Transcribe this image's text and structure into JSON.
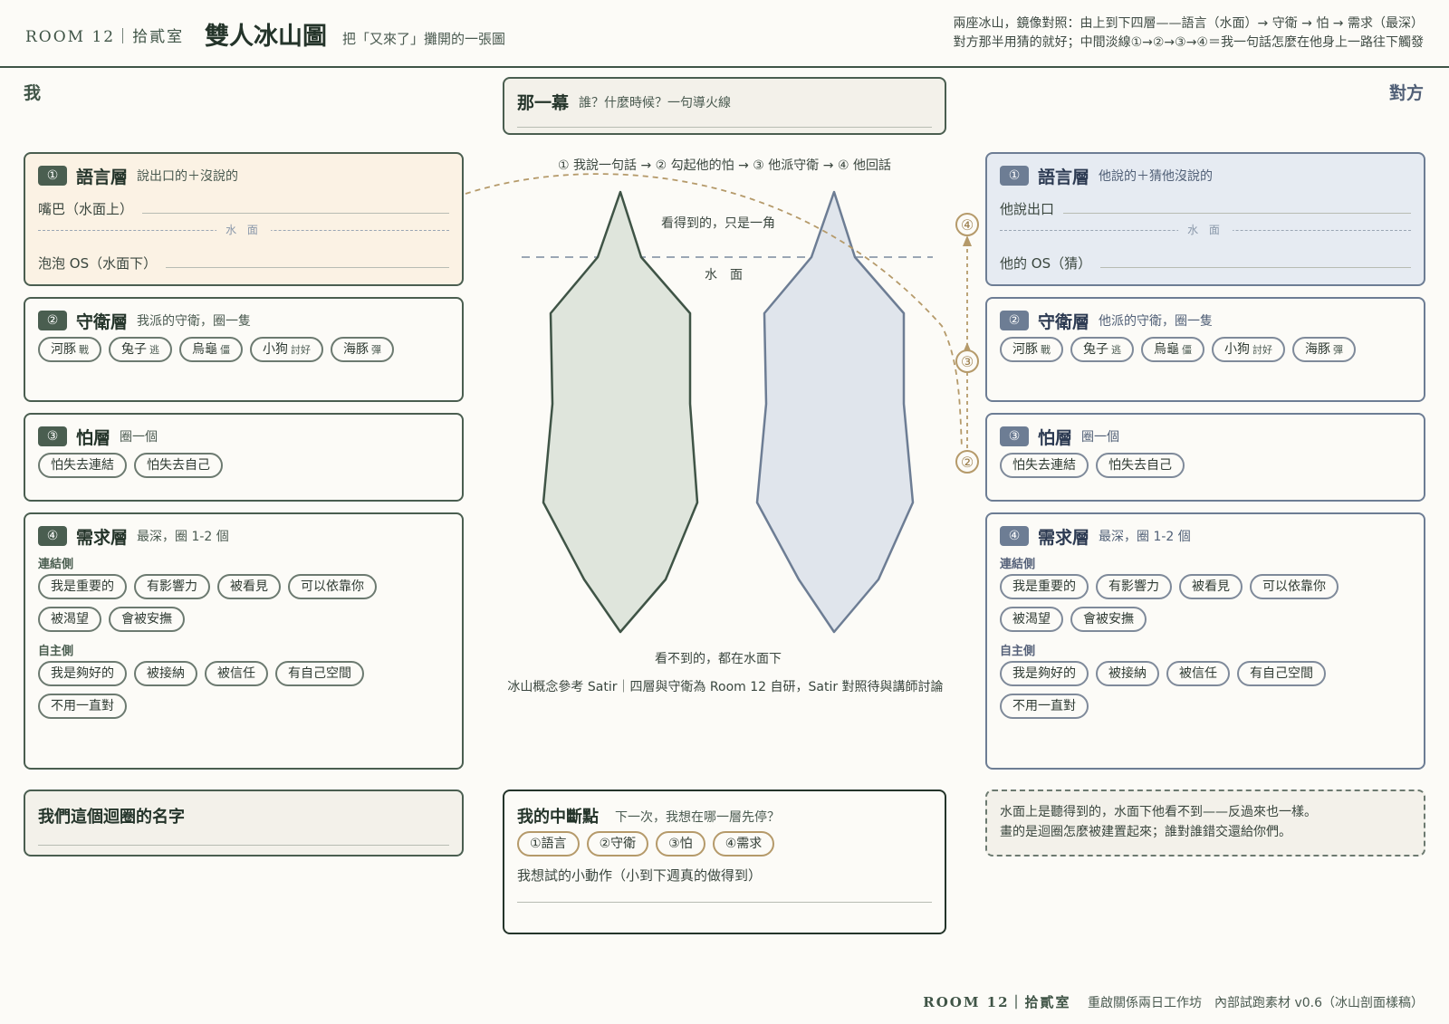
{
  "header": {
    "brand": "ROOM 12｜拾貳室",
    "title": "雙人冰山圖",
    "subtitle": "把「又來了」攤開的一張圖",
    "note_line1": "兩座冰山，鏡像對照：由上到下四層——語言（水面）→ 守衛 → 怕 → 需求（最深）",
    "note_line2": "對方那半用猜的就好；中間淡線①→②→③→④＝我一句話怎麼在他身上一路往下觸發"
  },
  "sides": {
    "me": "我",
    "them": "對方"
  },
  "me": {
    "language": {
      "num": "①",
      "name": "語言層",
      "hint": "說出口的＋沒說的",
      "line1": "嘴巴（水面上）",
      "water": "水 面",
      "line2": "泡泡 OS（水面下）"
    },
    "guard": {
      "num": "②",
      "name": "守衛層",
      "hint": "我派的守衛，圈一隻",
      "chips": [
        {
          "label": "河豚",
          "tag": "戰"
        },
        {
          "label": "兔子",
          "tag": "逃"
        },
        {
          "label": "烏龜",
          "tag": "僵"
        },
        {
          "label": "小狗",
          "tag": "討好"
        },
        {
          "label": "海豚",
          "tag": "彈"
        }
      ]
    },
    "fear": {
      "num": "③",
      "name": "怕層",
      "hint": "圈一個",
      "chips": [
        "怕失去連結",
        "怕失去自己"
      ]
    },
    "need": {
      "num": "④",
      "name": "需求層",
      "hint": "最深，圈 1-2 個",
      "connect_label": "連結側",
      "connect": [
        "我是重要的",
        "有影響力",
        "被看見",
        "可以依靠你",
        "被渴望",
        "會被安撫"
      ],
      "auto_label": "自主側",
      "auto": [
        "我是夠好的",
        "被接納",
        "被信任",
        "有自己空間",
        "不用一直對"
      ]
    }
  },
  "them": {
    "language": {
      "num": "①",
      "name": "語言層",
      "hint": "他說的＋猜他沒說的",
      "line1": "他說出口",
      "water": "水 面",
      "line2": "他的 OS（猜）"
    },
    "guard": {
      "num": "②",
      "name": "守衛層",
      "hint": "他派的守衛，圈一隻",
      "chips": [
        {
          "label": "河豚",
          "tag": "戰"
        },
        {
          "label": "兔子",
          "tag": "逃"
        },
        {
          "label": "烏龜",
          "tag": "僵"
        },
        {
          "label": "小狗",
          "tag": "討好"
        },
        {
          "label": "海豚",
          "tag": "彈"
        }
      ]
    },
    "fear": {
      "num": "③",
      "name": "怕層",
      "hint": "圈一個",
      "chips": [
        "怕失去連結",
        "怕失去自己"
      ]
    },
    "need": {
      "num": "④",
      "name": "需求層",
      "hint": "最深，圈 1-2 個",
      "connect_label": "連結側",
      "connect": [
        "我是重要的",
        "有影響力",
        "被看見",
        "可以依靠你",
        "被渴望",
        "會被安撫"
      ],
      "auto_label": "自主側",
      "auto": [
        "我是夠好的",
        "被接納",
        "被信任",
        "有自己空間",
        "不用一直對"
      ]
    }
  },
  "center": {
    "scene_title": "那一幕",
    "scene_hint": "誰？什麼時候？一句導火線",
    "flow": "① 我說一句話 → ② 勾起他的怕 → ③ 他派守衛 → ④ 他回話",
    "visible": "看得到的，只是一角",
    "water": "水　面",
    "hidden": "看不到的，都在水面下",
    "reference": "冰山概念參考 Satir｜四層與守衛為 Room 12 自研，Satir 對照待與講師討論",
    "markers": [
      "④",
      "③",
      "②"
    ]
  },
  "colors": {
    "me_ice": "#dfe5dc",
    "me_stroke": "#3f5446",
    "them_ice": "#e0e5ec",
    "them_stroke": "#6d7d94",
    "accent": "#b59a6a",
    "water_line": "#9aa6b4"
  },
  "bottom": {
    "name_title": "我們這個迴圈的名字",
    "break_title": "我的中斷點",
    "break_hint": "下一次，我想在哪一層先停？",
    "break_chips": [
      "①語言",
      "②守衛",
      "③怕",
      "④需求"
    ],
    "break_question": "我想試的小動作（小到下週真的做得到）",
    "note_line1": "水面上是聽得到的，水面下他看不到——反過來也一樣。",
    "note_line2": "畫的是迴圈怎麼被建置起來；誰對誰錯交還給你們。"
  },
  "footer": {
    "brand": "ROOM 12｜拾貳室",
    "text": "重啟關係兩日工作坊　內部試跑素材 v0.6（冰山剖面樣稿）"
  }
}
